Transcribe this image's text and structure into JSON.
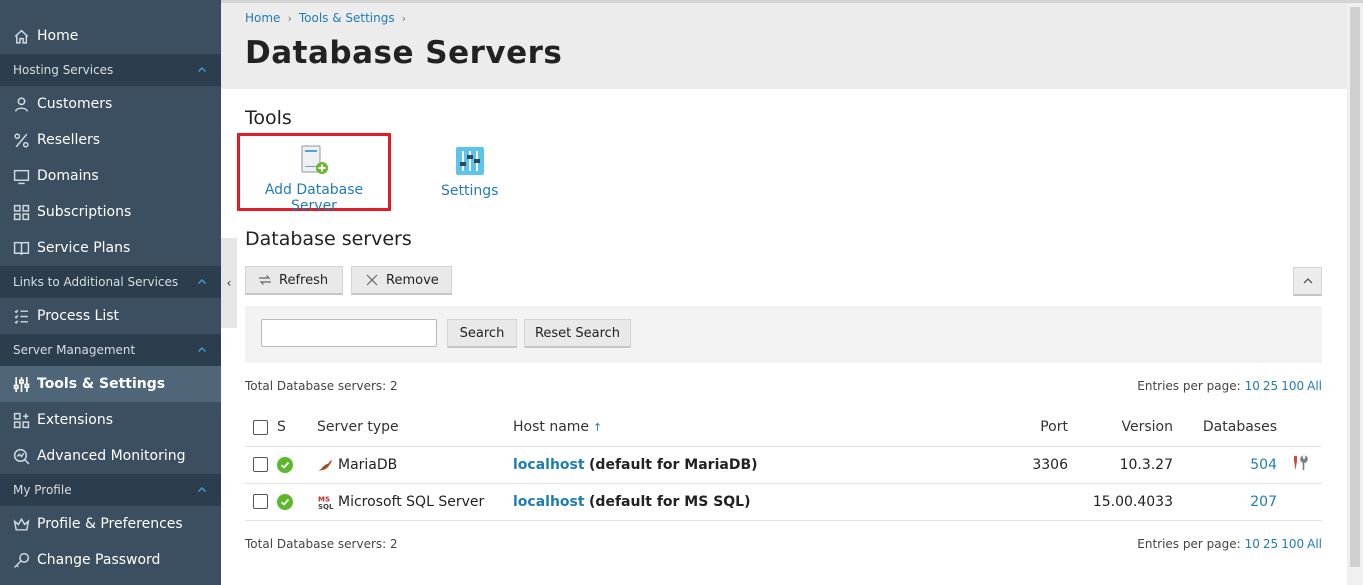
{
  "sidebar": {
    "home": "Home",
    "hosting_section": "Hosting Services",
    "customers": "Customers",
    "resellers": "Resellers",
    "domains": "Domains",
    "subscriptions": "Subscriptions",
    "service_plans": "Service Plans",
    "links_section": "Links to Additional Services",
    "process_list": "Process List",
    "server_section": "Server Management",
    "tools_settings": "Tools & Settings",
    "extensions": "Extensions",
    "advanced_monitoring": "Advanced Monitoring",
    "profile_section": "My Profile",
    "profile_prefs": "Profile & Preferences",
    "change_password": "Change Password"
  },
  "breadcrumb": {
    "home": "Home",
    "tools": "Tools & Settings"
  },
  "page": {
    "title": "Database Servers"
  },
  "tools": {
    "heading": "Tools",
    "add_label": "Add Database Server",
    "settings_label": "Settings"
  },
  "list": {
    "heading": "Database servers",
    "refresh": "Refresh",
    "remove": "Remove",
    "search_value": "",
    "search_btn": "Search",
    "reset_btn": "Reset Search",
    "total": "Total Database servers: 2",
    "entries_label": "Entries per page:",
    "pp": [
      "10",
      "25",
      "100",
      "All"
    ],
    "columns": {
      "s": "S",
      "type": "Server type",
      "host": "Host name",
      "port": "Port",
      "version": "Version",
      "databases": "Databases"
    },
    "rows": [
      {
        "type": "MariaDB",
        "host": "localhost",
        "host_note": "(default for MariaDB)",
        "port": "3306",
        "version": "10.3.27",
        "databases": "504"
      },
      {
        "type": "Microsoft SQL Server",
        "host": "localhost",
        "host_note": "(default for MS SQL)",
        "port": "",
        "version": "15.00.4033",
        "databases": "207"
      }
    ]
  },
  "colors": {
    "sidebar": "#3b4f61",
    "section": "#2c3e4e",
    "link": "#1f7db4",
    "highlight": "#e11c24",
    "ok": "#5cb82a"
  },
  "icons": [
    "home-icon",
    "user-icon",
    "percent-icon",
    "monitor-icon",
    "grid-icon",
    "book-icon",
    "list-icon",
    "sliders-icon",
    "extensions-icon",
    "monitoring-icon",
    "crown-icon",
    "key-icon"
  ]
}
